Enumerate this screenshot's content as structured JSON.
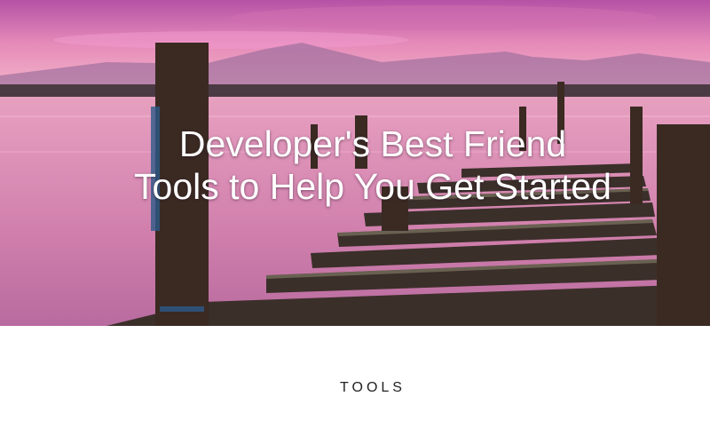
{
  "hero": {
    "line1": "Developer's Best Friend",
    "line2": "Tools to Help You Get Started",
    "image": "sunset-pier-lake"
  },
  "section": {
    "heading": "TOOLS"
  },
  "colors": {
    "sky_top": "#c85aa8",
    "sky_mid": "#e889b8",
    "horizon": "#f3b7c6",
    "water": "#d98fb0",
    "wood": "#3b2f2a",
    "text": "#222222"
  }
}
